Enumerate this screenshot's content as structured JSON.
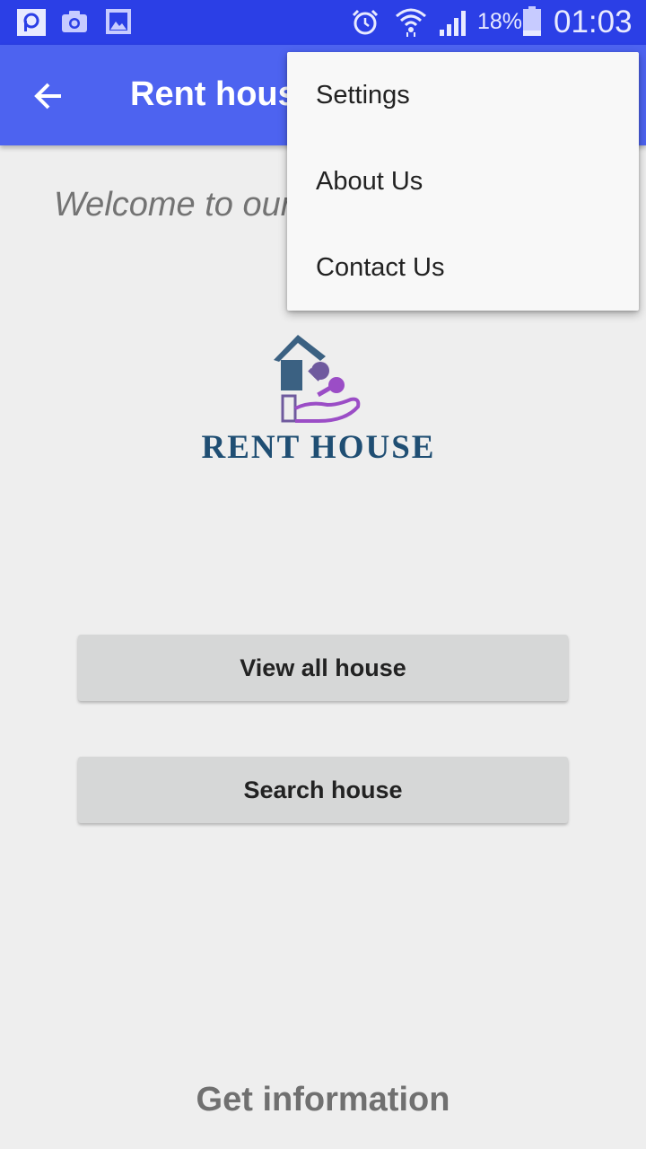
{
  "status_bar": {
    "battery_percent": "18%",
    "time": "01:03"
  },
  "app_bar": {
    "title": "Rent house"
  },
  "main": {
    "welcome_text": "Welcome to our",
    "logo_wordmark": "RENT HOUSE",
    "view_all_button": "View all house",
    "search_button": "Search house",
    "footer_heading": "Get information"
  },
  "overflow_menu": {
    "items": [
      {
        "label": "Settings"
      },
      {
        "label": "About Us"
      },
      {
        "label": "Contact Us"
      }
    ]
  },
  "colors": {
    "status_bar": "#2b3fe6",
    "app_bar": "#4d63f0",
    "background": "#eeeeee",
    "button": "#d6d7d7",
    "logo_blue": "#1f4e73",
    "logo_purple": "#9b4dc6"
  }
}
